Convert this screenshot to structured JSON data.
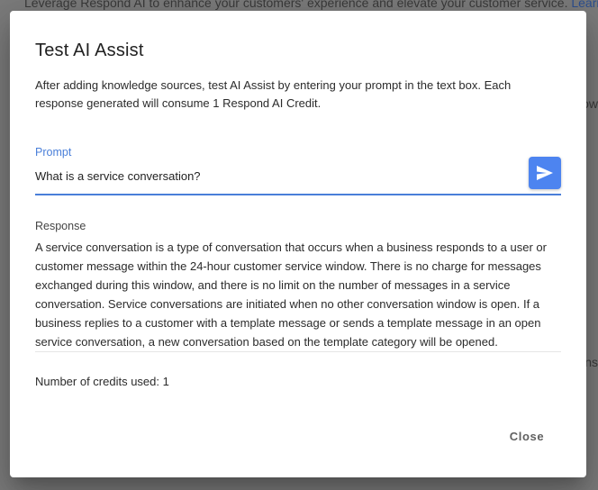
{
  "background": {
    "top_text": "Leverage Respond AI to enhance your customers' experience and elevate your customer service.",
    "top_link": "Learn",
    "side_text_1": "ow",
    "side_text_2": "ns"
  },
  "dialog": {
    "title": "Test AI Assist",
    "description": "After adding knowledge sources, test AI Assist by entering your prompt in the text box. Each response generated will consume 1 Respond AI Credit.",
    "prompt": {
      "label": "Prompt",
      "value": "What is a service conversation?",
      "send_icon": "send-icon"
    },
    "response": {
      "label": "Response",
      "text": "A service conversation is a type of conversation that occurs when a business responds to a user or customer message within the 24-hour customer service window. There is no charge for messages exchanged during this window, and there is no limit on the number of messages in a service conversation. Service conversations are initiated when no other conversation window is open. If a business replies to a customer with a template message or sends a template message in an open service conversation, a new conversation based on the template category will be opened."
    },
    "credits_text": "Number of credits used: 1",
    "close_label": "Close"
  },
  "colors": {
    "accent": "#4a7fd9",
    "send_button": "#4d84f0",
    "overlay": "#7b7b7b"
  }
}
